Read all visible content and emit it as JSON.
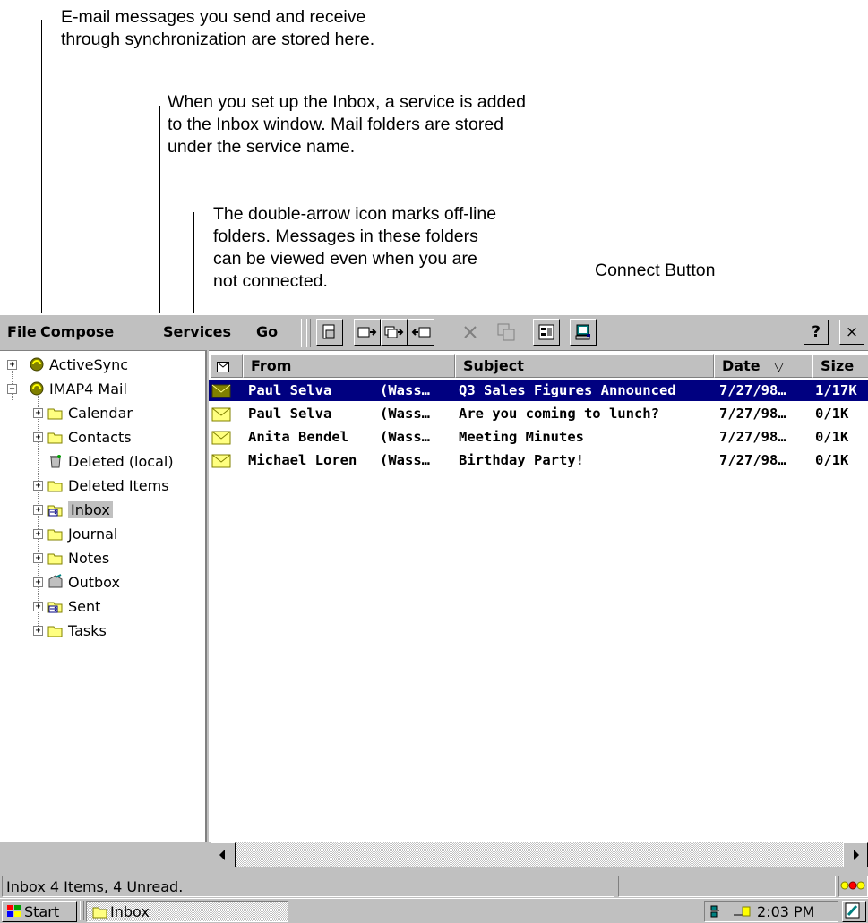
{
  "callouts": {
    "c1": [
      "E-mail messages you send and receive",
      "through synchronization are stored here."
    ],
    "c2": [
      "When you set up the Inbox, a service is added",
      "to the Inbox window. Mail folders are stored",
      "under the service name."
    ],
    "c3": [
      "The double-arrow icon marks off-line",
      "folders. Messages in these folders",
      "can be viewed even when you are",
      "not connected."
    ],
    "c4": "Connect Button"
  },
  "menu": {
    "file": {
      "accel": "F",
      "rest": "ile"
    },
    "compose": {
      "accel": "C",
      "rest": "ompose"
    },
    "services": {
      "accel": "S",
      "rest": "ervices"
    },
    "go": {
      "accel": "G",
      "rest": "o"
    }
  },
  "window_buttons": {
    "help": "?",
    "close": "×"
  },
  "tree": {
    "activesync": "ActiveSync",
    "imap4": "IMAP4 Mail",
    "folders": [
      "Calendar",
      "Contacts",
      "Deleted (local)",
      "Deleted Items",
      "Inbox",
      "Journal",
      "Notes",
      "Outbox",
      "Sent",
      "Tasks"
    ]
  },
  "columns": {
    "from": "From",
    "subject": "Subject",
    "date": "Date",
    "size": "Size",
    "sort_glyph": "▽"
  },
  "messages": [
    {
      "from": "Paul Selva",
      "extra": "(Wass…",
      "subject": "Q3 Sales Figures Announced",
      "date": "7/27/98…",
      "size": "1/17K"
    },
    {
      "from": "Paul Selva",
      "extra": "(Wass…",
      "subject": "Are you coming to lunch?",
      "date": "7/27/98…",
      "size": "0/1K"
    },
    {
      "from": "Anita Bendel",
      "extra": "(Wass…",
      "subject": "Meeting Minutes",
      "date": "7/27/98…",
      "size": "0/1K"
    },
    {
      "from": "Michael Loren",
      "extra": "(Wass…",
      "subject": "Birthday Party!",
      "date": "7/27/98…",
      "size": "0/1K"
    }
  ],
  "status": {
    "text": "Inbox 4 Items, 4 Unread."
  },
  "taskbar": {
    "start": "Start",
    "task": "Inbox",
    "clock": "2:03 PM"
  },
  "colors": {
    "selection": "#000080",
    "face": "#c0c0c0"
  }
}
